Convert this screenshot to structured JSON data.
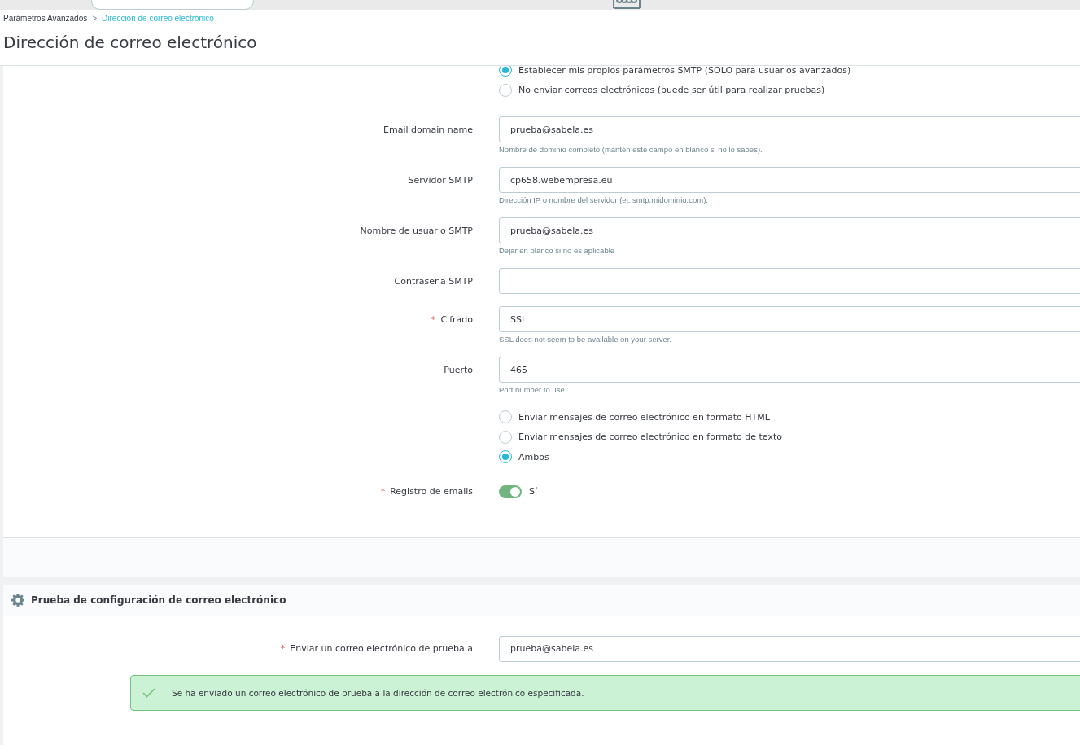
{
  "breadcrumb": {
    "parent": "Parámetros Avanzados",
    "separator": ">",
    "current": "Dirección de correo electrónico"
  },
  "page_title": "Dirección de correo electrónico",
  "rows": [
    {
      "kind": "radio_group",
      "options": [
        {
          "label": "Establecer mis propios parámetros SMTP (SOLO para usuarios avanzados)",
          "selected": true
        },
        {
          "label": "No enviar correos electrónicos (puede ser útil para realizar pruebas)",
          "selected": false
        }
      ]
    },
    {
      "kind": "field",
      "label": "Email domain name",
      "value": "prueba@sabela.es",
      "help": "Nombre de dominio completo (mantén este campo en blanco si no lo sabes)."
    },
    {
      "kind": "field",
      "label": "Servidor SMTP",
      "value": "cp658.webempresa.eu",
      "help": "Dirección IP o nombre del servidor (ej. smtp.midominio.com)."
    },
    {
      "kind": "field",
      "label": "Nombre de usuario SMTP",
      "value": "prueba@sabela.es",
      "help": "Dejar en blanco si no es aplicable"
    },
    {
      "kind": "field",
      "label": "Contraseña SMTP"
    },
    {
      "kind": "field",
      "label": "Cifrado",
      "required_mark": "*",
      "value": "SSL",
      "help": "SSL does not seem to be available on your server."
    },
    {
      "kind": "field",
      "label": "Puerto",
      "value": "465",
      "help": "Port number to use."
    },
    {
      "kind": "radio_group",
      "options": [
        {
          "label": "Enviar mensajes de correo electrónico en formato HTML",
          "selected": false
        },
        {
          "label": "Enviar mensajes de correo electrónico en formato de texto",
          "selected": false
        },
        {
          "label": "Ambos",
          "selected": true
        }
      ]
    },
    {
      "kind": "switch",
      "label": "Registro de emails",
      "required_mark": "*",
      "on": true,
      "state_label": "Sí"
    }
  ],
  "test_panel": {
    "title": "Prueba de configuración de correo electrónico",
    "field": {
      "label": "Enviar un correo electrónico de prueba a",
      "required_mark": "*",
      "value": "prueba@sabela.es"
    },
    "alert": {
      "message": "Se ha enviado un correo electrónico de prueba a la dirección de correo electrónico especificada."
    }
  }
}
